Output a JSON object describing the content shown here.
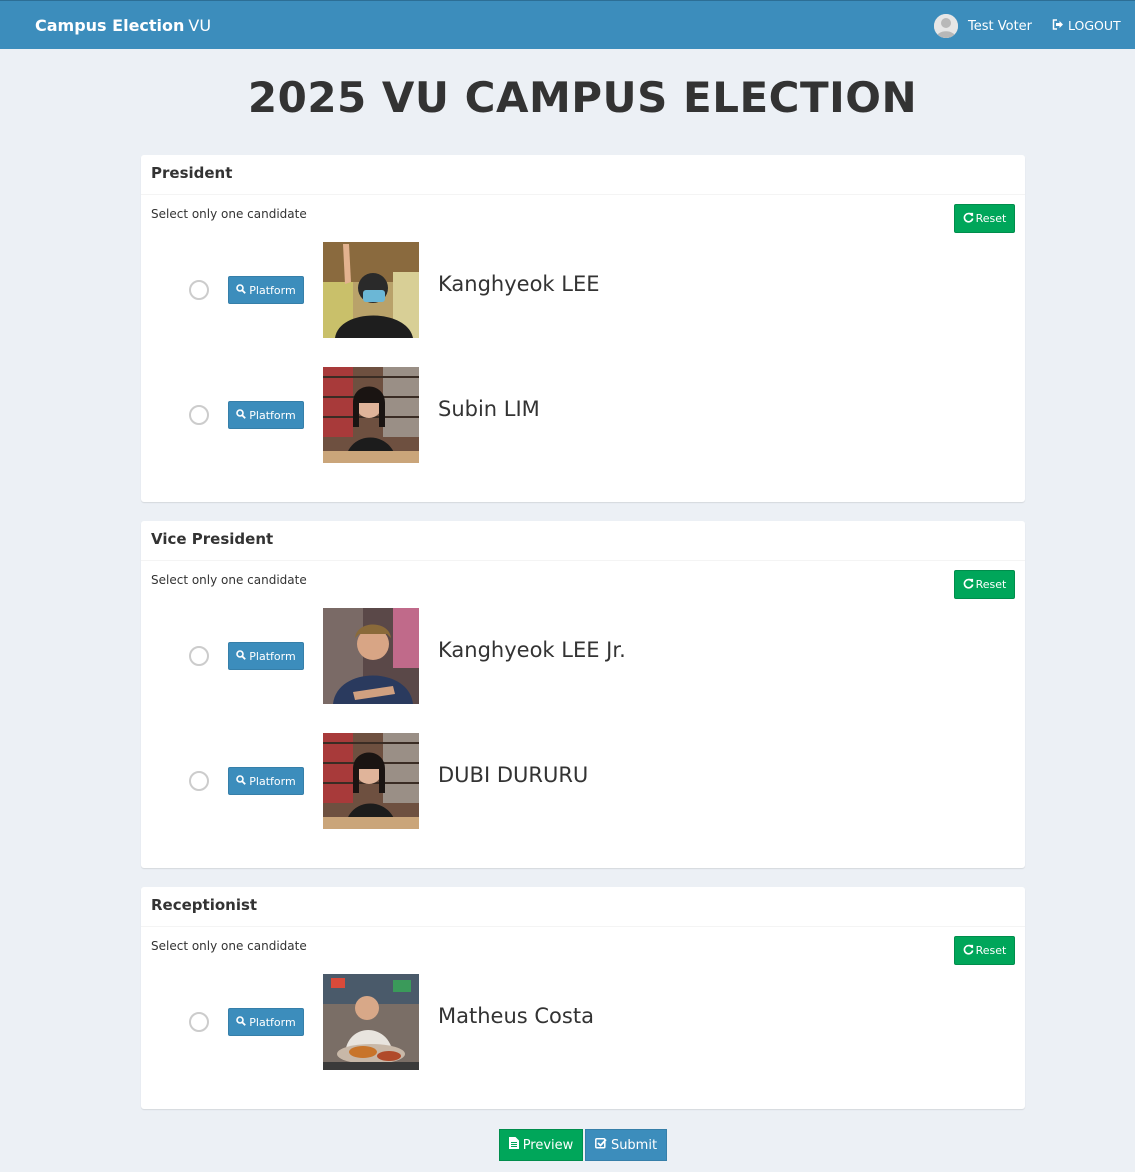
{
  "navbar": {
    "brand_bold": "Campus Election",
    "brand_suffix": "VU",
    "user_name": "Test Voter",
    "logout_label": "LOGOUT"
  },
  "page_title": "2025 VU CAMPUS ELECTION",
  "positions": [
    {
      "title": "President",
      "instruction": "Select only one candidate",
      "reset_label": "Reset",
      "candidates": [
        {
          "name": "Kanghyeok LEE",
          "platform_label": "Platform",
          "selected": false
        },
        {
          "name": "Subin LIM",
          "platform_label": "Platform",
          "selected": false
        }
      ]
    },
    {
      "title": "Vice President",
      "instruction": "Select only one candidate",
      "reset_label": "Reset",
      "candidates": [
        {
          "name": "Kanghyeok LEE Jr.",
          "platform_label": "Platform",
          "selected": false
        },
        {
          "name": "DUBI DURURU",
          "platform_label": "Platform",
          "selected": false
        }
      ]
    },
    {
      "title": "Receptionist",
      "instruction": "Select only one candidate",
      "reset_label": "Reset",
      "candidates": [
        {
          "name": "Matheus Costa",
          "platform_label": "Platform",
          "selected": false
        }
      ]
    }
  ],
  "actions": {
    "preview_label": "Preview",
    "submit_label": "Submit"
  },
  "colors": {
    "navbar": "#3c8dbc",
    "success": "#00a65a",
    "primary": "#3c8dbc",
    "page_bg": "#ecf0f5"
  }
}
